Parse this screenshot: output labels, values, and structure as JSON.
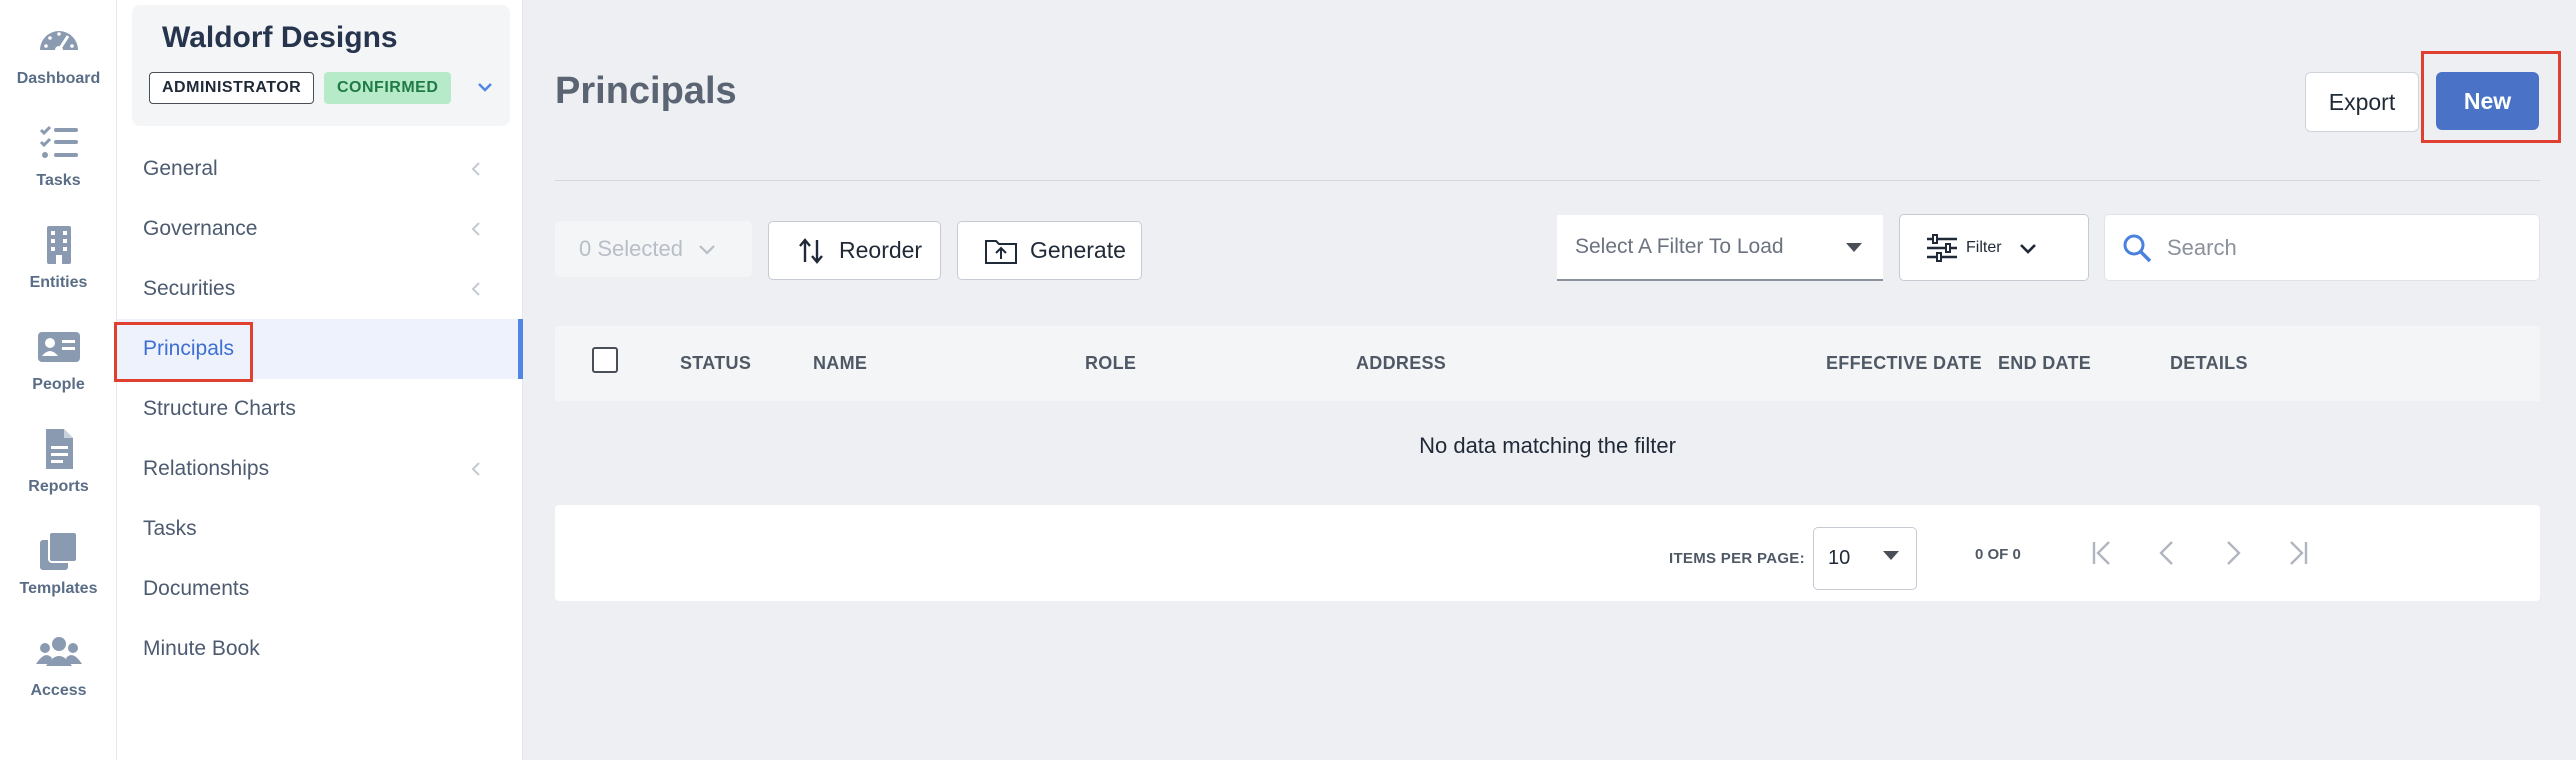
{
  "rail": {
    "items": [
      {
        "label": "Dashboard",
        "icon": "dashboard-gauge-icon"
      },
      {
        "label": "Tasks",
        "icon": "tasks-checklist-icon"
      },
      {
        "label": "Entities",
        "icon": "entities-building-icon"
      },
      {
        "label": "People",
        "icon": "people-id-card-icon"
      },
      {
        "label": "Reports",
        "icon": "reports-document-icon"
      },
      {
        "label": "Templates",
        "icon": "templates-copy-icon"
      },
      {
        "label": "Access",
        "icon": "access-users-icon"
      }
    ]
  },
  "org": {
    "name": "Waldorf Designs",
    "role_badge": "ADMINISTRATOR",
    "status_badge": "CONFIRMED"
  },
  "nav": {
    "items": [
      {
        "label": "General",
        "has_chevron": true
      },
      {
        "label": "Governance",
        "has_chevron": true
      },
      {
        "label": "Securities",
        "has_chevron": true
      },
      {
        "label": "Principals",
        "active": true
      },
      {
        "label": "Structure Charts"
      },
      {
        "label": "Relationships",
        "has_chevron": true
      },
      {
        "label": "Tasks"
      },
      {
        "label": "Documents"
      },
      {
        "label": "Minute Book"
      }
    ]
  },
  "header": {
    "title": "Principals",
    "export_label": "Export",
    "new_label": "New"
  },
  "toolbar": {
    "selected_label": "0 Selected",
    "reorder_label": "Reorder",
    "generate_label": "Generate",
    "filter_select_placeholder": "Select A Filter To Load",
    "filter_label": "Filter",
    "search_placeholder": "Search"
  },
  "table": {
    "columns": [
      "STATUS",
      "NAME",
      "ROLE",
      "ADDRESS",
      "EFFECTIVE DATE",
      "END DATE",
      "DETAILS"
    ],
    "rows": [],
    "empty_message": "No data matching the filter"
  },
  "pagination": {
    "items_per_page_label": "ITEMS PER PAGE:",
    "items_per_page": "10",
    "range": "0 OF 0"
  },
  "colors": {
    "primary": "#4a73c8",
    "active_nav_bg": "#edf2fd",
    "active_nav_text": "#3e6fd1",
    "confirmed_bg": "#b7eac9",
    "confirmed_text": "#1f7a46",
    "highlight": "#e0402f"
  }
}
